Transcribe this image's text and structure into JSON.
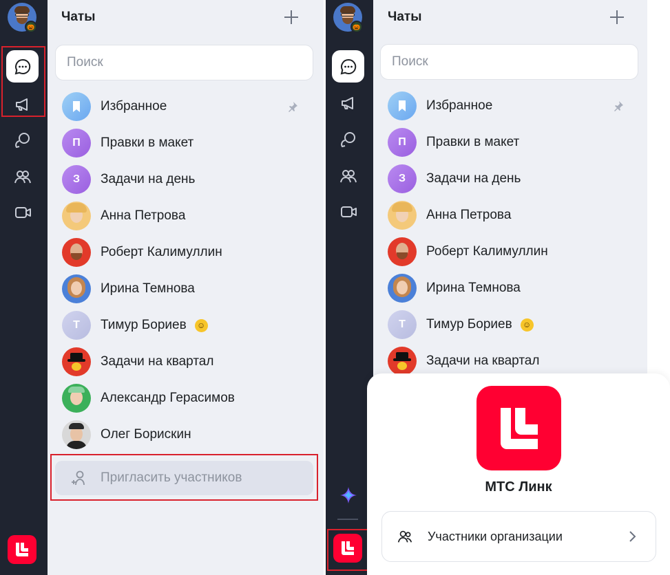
{
  "left": {
    "header": {
      "title": "Чаты"
    },
    "search": {
      "placeholder": "Поиск"
    },
    "chats": [
      {
        "name": "Избранное",
        "avatar_type": "bookmark-icon",
        "pinned": true
      },
      {
        "name": "Правки в макет",
        "initial": "П",
        "color": "#a66ee6"
      },
      {
        "name": "Задачи на день",
        "initial": "З",
        "color": "#a66ee6"
      },
      {
        "name": "Анна Петрова",
        "avatar_type": "photo"
      },
      {
        "name": "Роберт Калимуллин",
        "avatar_type": "photo"
      },
      {
        "name": "Ирина Темнова",
        "avatar_type": "photo"
      },
      {
        "name": "Тимур Бориев",
        "initial": "Т",
        "color": "#c2c6e6",
        "emoji": "smiley"
      },
      {
        "name": "Задачи на квартал",
        "avatar_type": "photo"
      },
      {
        "name": "Александр Герасимов",
        "avatar_type": "photo"
      },
      {
        "name": "Олег Борискин",
        "avatar_type": "photo"
      }
    ],
    "invite": {
      "label": "Пригласить участников"
    }
  },
  "right": {
    "header": {
      "title": "Чаты"
    },
    "search": {
      "placeholder": "Поиск"
    },
    "chats": [
      {
        "name": "Избранное"
      },
      {
        "name": "Правки в макет",
        "initial": "П"
      },
      {
        "name": "Задачи на день",
        "initial": "З"
      },
      {
        "name": "Анна Петрова"
      },
      {
        "name": "Роберт Калимуллин"
      },
      {
        "name": "Ирина Темнова"
      },
      {
        "name": "Тимур Бориев",
        "initial": "Т"
      },
      {
        "name": "Задачи на квартал"
      }
    ],
    "popup": {
      "app_name": "МТС Линк",
      "org_button": "Участники организации"
    }
  },
  "colors": {
    "rail": "#1f2430",
    "list_bg": "#eef0f5",
    "brand": "#ff0032",
    "highlight_outline": "#d9212c"
  }
}
